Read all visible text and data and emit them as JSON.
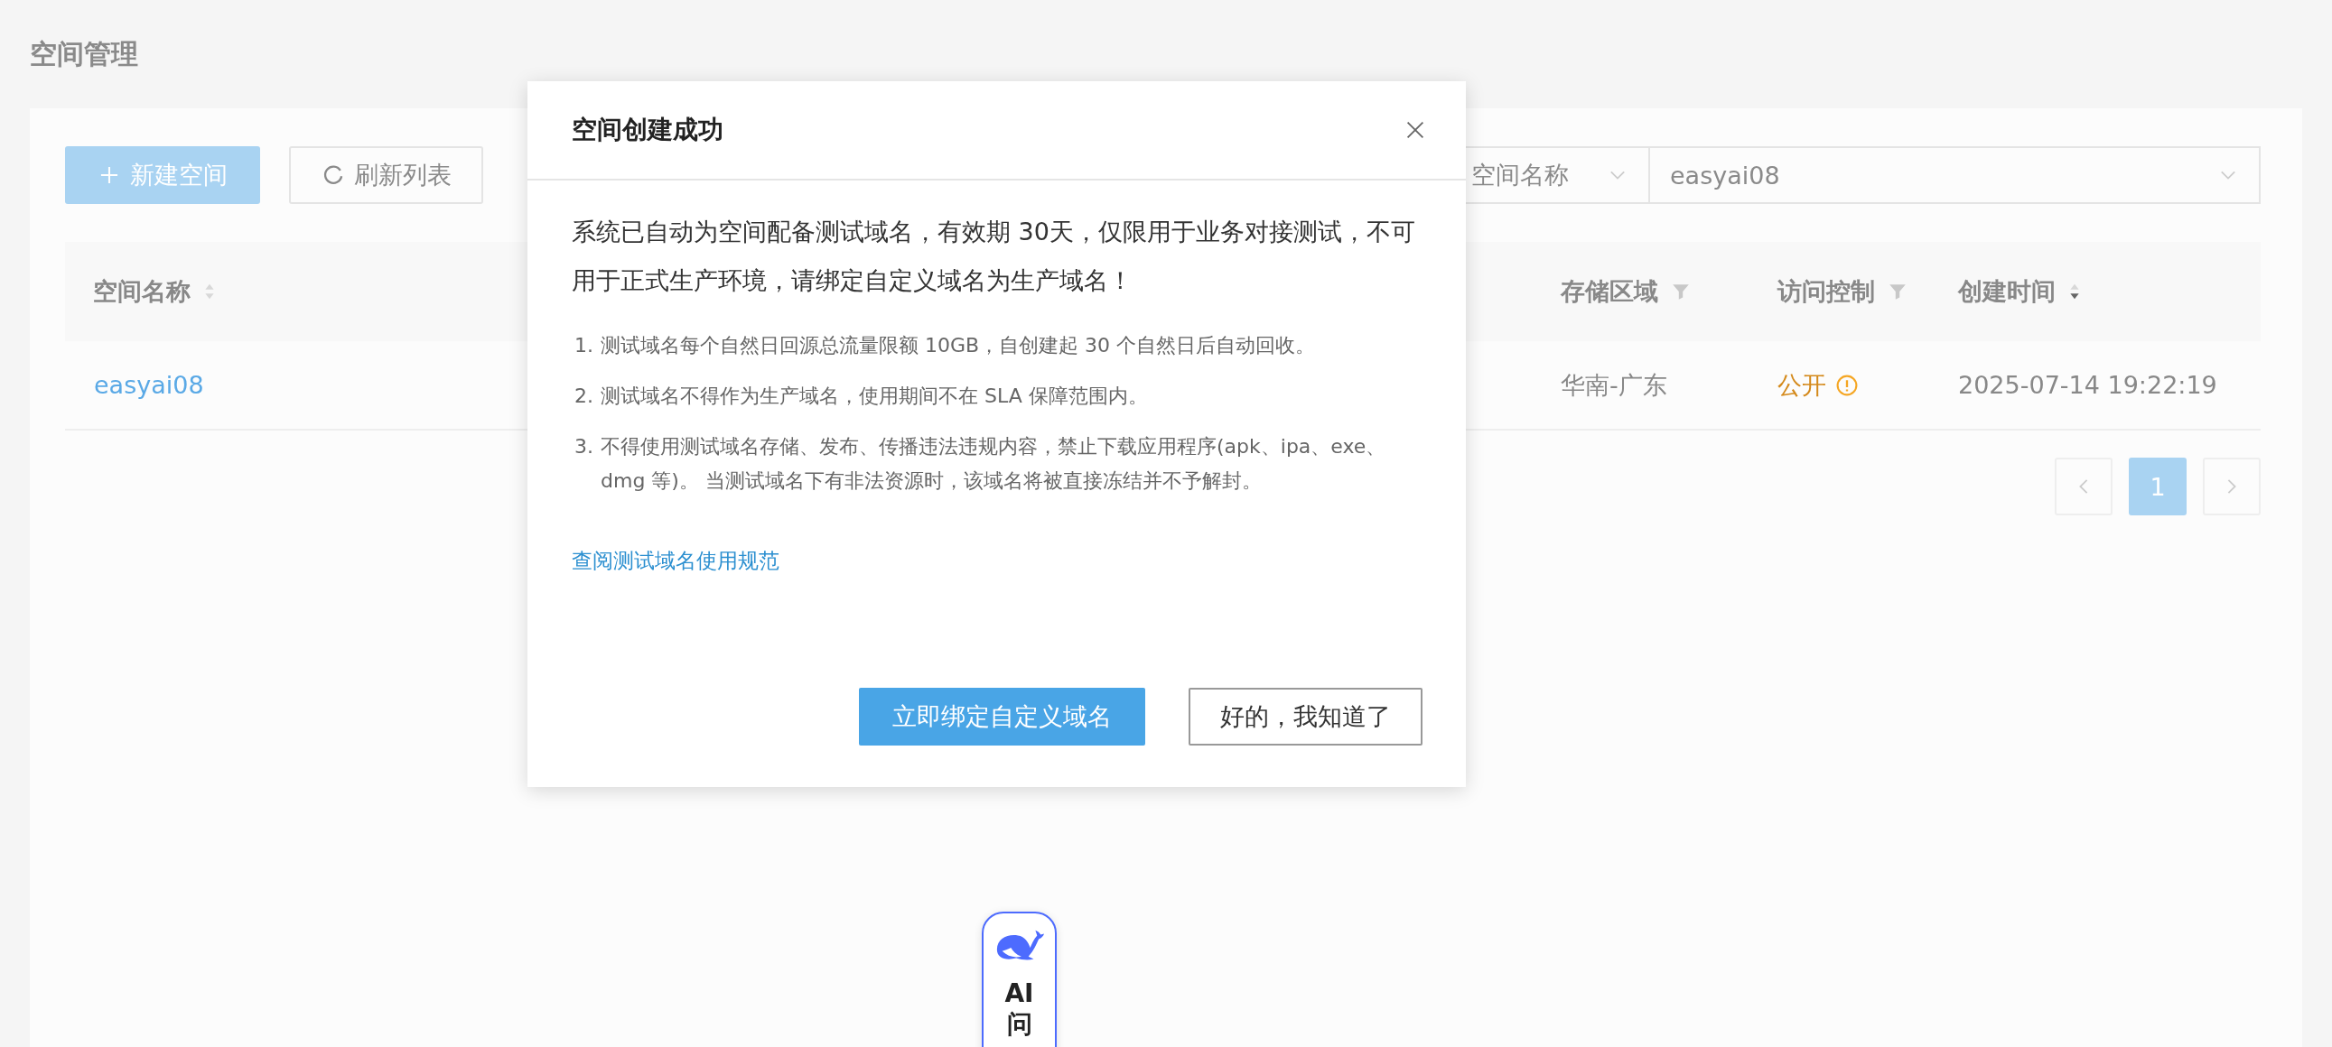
{
  "page": {
    "title": "空间管理"
  },
  "toolbar": {
    "buttons": [
      {
        "label": "新建空间",
        "kind": "primary"
      },
      {
        "label": "刷新列表",
        "kind": "refresh"
      }
    ],
    "filter": {
      "field": "空间名称",
      "value": "easyai08"
    }
  },
  "table": {
    "columns": [
      {
        "label": "空间名称",
        "kind": "sort",
        "sort_desc": false
      },
      {
        "label": "存储区域",
        "kind": "filter"
      },
      {
        "label": "访问控制",
        "kind": "filter"
      },
      {
        "label": "创建时间",
        "kind": "sort",
        "sort_desc": true
      }
    ],
    "rows": [
      {
        "cells": [
          {
            "text": "easyai08",
            "kind": "link"
          },
          {
            "text": "华南-广东",
            "kind": "text"
          },
          {
            "text": "公开",
            "kind": "status"
          },
          {
            "text": "2025-07-14 19:22:19",
            "kind": "text"
          }
        ]
      }
    ]
  },
  "pagination": {
    "pages": [
      {
        "label": "1",
        "selected": true
      }
    ]
  },
  "dialog": {
    "title": "空间创建成功",
    "intro": "系统已自动为空间配备测试域名，有效期 30天，仅限用于业务对接测试，不可用于正式生产环境，请绑定自定义域名为生产域名！",
    "notes": [
      {
        "number": "1.",
        "text": "测试域名每个自然日回源总流量限额 10GB，自创建起 30 个自然日后自动回收。"
      },
      {
        "number": "2.",
        "text": "测试域名不得作为生产域名，使用期间不在 SLA 保障范围内。"
      },
      {
        "number": "3.",
        "text": "不得使用测试域名存储、发布、传播违法违规内容，禁止下载应用程序(apk、ipa、exe、dmg 等)。 当测试域名下有非法资源时，该域名将被直接冻结并不予解封。"
      }
    ],
    "link": "查阅测试域名使用规范",
    "buttons": [
      {
        "label": "立即绑定自定义域名",
        "kind": "primary"
      },
      {
        "label": "好的，我知道了",
        "kind": "default"
      }
    ]
  },
  "ai_button": {
    "label": "AI问"
  }
}
